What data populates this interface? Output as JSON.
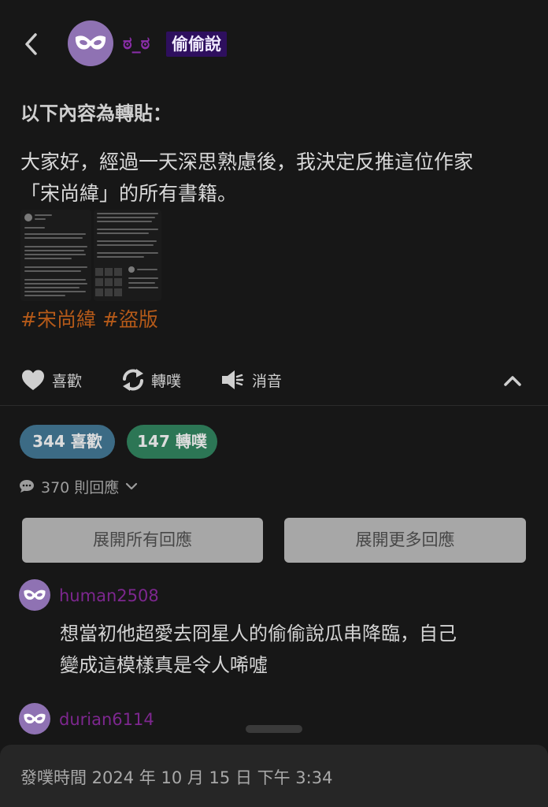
{
  "header": {
    "username": "ಠ_ಠ",
    "board": "偷偷說"
  },
  "post": {
    "intro": "以下內容為轉貼：",
    "text": "大家好，經過一天深思熟慮後，我決定反推這位作家\n「宋尚緯」的所有書籍。",
    "hashtags": [
      "#宋尚緯",
      "#盜版"
    ]
  },
  "actions": {
    "like": "喜歡",
    "share": "轉噗",
    "mute": "消音"
  },
  "stats": {
    "likes": "344 喜歡",
    "shares": "147 轉噗",
    "replies": "370 則回應"
  },
  "buttons": {
    "expand_all": "展開所有回應",
    "expand_more": "展開更多回應"
  },
  "comments": [
    {
      "user": "human2508",
      "text": "想當初他超愛去冏星人的偷偷說瓜串降臨，自己\n變成這模樣真是令人唏噓"
    },
    {
      "user": "durian6114"
    }
  ],
  "footer": {
    "post_time": "發噗時間 2024 年 10 月 15 日 下午 3:34"
  },
  "colors": {
    "background": "#171717",
    "username": "#8a2ea8",
    "board_tag_bg": "#2e0f5e",
    "hashtag": "#b55a19",
    "likes_pill": "#3c6b85",
    "shares_pill": "#2c7655",
    "avatar": "#8f72b3"
  },
  "icons": [
    "back-arrow-icon",
    "mask-icon",
    "heart-icon",
    "replurk-icon",
    "mute-speaker-icon",
    "chevron-up-icon",
    "speech-bubble-icon",
    "chevron-down-icon"
  ]
}
